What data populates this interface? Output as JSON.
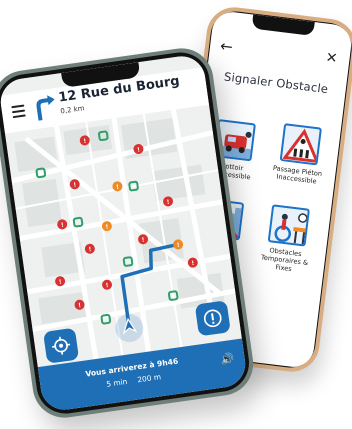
{
  "report_screen": {
    "back_symbol": "←",
    "close_symbol": "✕",
    "title": "Signaler Obstacle",
    "tiles": [
      {
        "label_1": "Trottoir",
        "label_2": "Inaccessible",
        "icon": "car-on-sidewalk-icon"
      },
      {
        "label_1": "Passage Piéton",
        "label_2": "Inaccessible",
        "icon": "crosswalk-warning-icon"
      },
      {
        "label_1": "",
        "label_2": "",
        "icon": "stairs-icon"
      },
      {
        "label_1": "Obstacles",
        "label_2": "Temporaires & Fixes",
        "icon": "wheelchair-barrier-icon"
      }
    ]
  },
  "nav_screen": {
    "street_name": "12 Rue du Bourg",
    "distance": "0,2 km",
    "eta_text": "Vous arriverez à 9h46",
    "duration": "5 min",
    "remaining_distance": "200 m",
    "speaker_symbol": "🔊"
  },
  "colors": {
    "primary_blue": "#1f6fb6",
    "alert_red": "#d8312f",
    "warning_orange": "#f08a24",
    "transit_green": "#2e9e6a",
    "phone_gold": "#d9ad82",
    "phone_green": "#6e7f7a"
  }
}
